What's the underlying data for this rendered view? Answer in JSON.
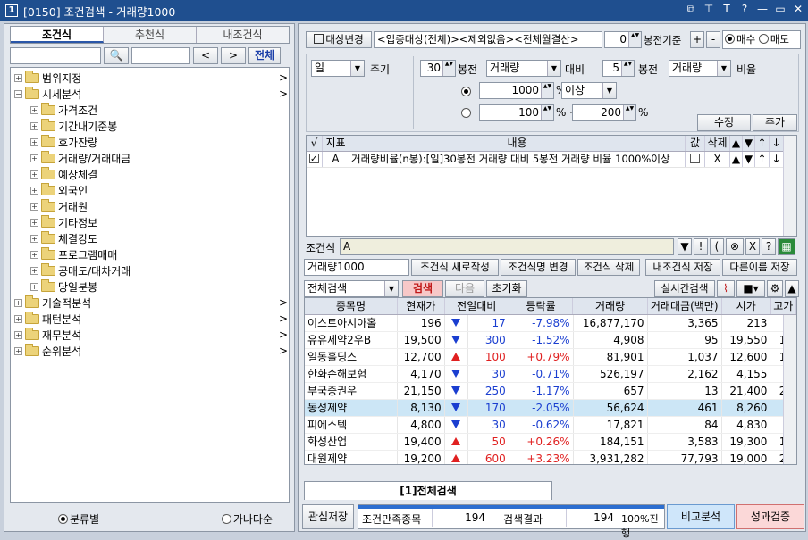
{
  "window": {
    "num": "1",
    "title": "[0150] 조건검색 - 거래량1000",
    "icons": [
      "layout-icon",
      "pin-icon",
      "font-icon",
      "help-icon",
      "minimize-icon",
      "maximize-icon",
      "close-icon"
    ],
    "icon_glyphs": [
      "⧉",
      "⊤",
      "T",
      "?",
      "—",
      "▭",
      "✕"
    ]
  },
  "left": {
    "tabs": [
      "조건식",
      "추천식",
      "내조건식"
    ],
    "search_btn": "🔍",
    "prev": "<",
    "next": ">",
    "all": "전체",
    "tree": [
      {
        "label": "범위지정",
        "level": 0,
        "arrow": ">"
      },
      {
        "label": "시세분석",
        "level": 0,
        "arrow": ">",
        "open": true
      },
      {
        "label": "가격조건",
        "level": 1
      },
      {
        "label": "기간내기준봉",
        "level": 1
      },
      {
        "label": "호가잔량",
        "level": 1
      },
      {
        "label": "거래량/거래대금",
        "level": 1
      },
      {
        "label": "예상체결",
        "level": 1
      },
      {
        "label": "외국인",
        "level": 1
      },
      {
        "label": "거래원",
        "level": 1
      },
      {
        "label": "기타정보",
        "level": 1
      },
      {
        "label": "체결강도",
        "level": 1
      },
      {
        "label": "프로그램매매",
        "level": 1
      },
      {
        "label": "공매도/대차거래",
        "level": 1
      },
      {
        "label": "당일분봉",
        "level": 1
      },
      {
        "label": "기술적분석",
        "level": 0,
        "arrow": ">"
      },
      {
        "label": "패턴분석",
        "level": 0,
        "arrow": ">"
      },
      {
        "label": "재무분석",
        "level": 0,
        "arrow": ">"
      },
      {
        "label": "순위분석",
        "level": 0,
        "arrow": ">"
      }
    ],
    "radio1": "분류별",
    "radio2": "가나다순"
  },
  "right": {
    "target_btn": "대상변경",
    "target_text": "<업종대상(전체)><제외없음><전체월결산>",
    "bong_val": "0",
    "bong_label": "봉전기준",
    "plus": "+",
    "minus": "-",
    "buy": "매수",
    "sell": "매도",
    "period_sel": "일",
    "period_label": "주기",
    "n1": "30",
    "bong1": "봉전",
    "sel1": "거래량",
    "cmp": "대비",
    "n2": "5",
    "bong2": "봉전",
    "sel2": "거래량",
    "ratio": "비율",
    "v1": "1000",
    "pct": "%",
    "cond": "이상",
    "v2": "100",
    "pct_tilde": "% ~",
    "v3": "200",
    "pct2": "%",
    "edit": "수정",
    "add": "추가",
    "grid_head": [
      "√",
      "지표",
      "내용",
      "값",
      "삭제",
      "▲",
      "▼",
      "↑",
      "↓"
    ],
    "grid_row": {
      "ind": "A",
      "content": "거래량비율(n봉):[일]30봉전 거래량 대비 5봉전 거래량 비율 1000%이상",
      "del": "X",
      "u": "▲",
      "d": "▼",
      "uu": "↑",
      "dd": "↓"
    },
    "cond_label": "조건식",
    "cond_val": "A",
    "cond_btns": [
      "▼",
      "!",
      "(",
      ")",
      "⊗",
      "X",
      "?"
    ],
    "name_val": "거래량1000",
    "btns": [
      "조건식 새로작성",
      "조건식명 변경",
      "조건식 삭제",
      "내조건식 저장",
      "다른이름 저장"
    ],
    "scope": "전체검색",
    "search": "검색",
    "next": "다음",
    "reset": "초기화",
    "realtime": "실시간검색",
    "cols": [
      "종목명",
      "현재가",
      "전일대비",
      "등락률",
      "거래량",
      "거래대금(백만)",
      "시가",
      "고가"
    ],
    "rows": [
      [
        "이스트아시아홀",
        "196",
        "dn",
        "17",
        "-7.98%",
        "16,877,170",
        "3,365",
        "213",
        ""
      ],
      [
        "유유제약2우B",
        "19,500",
        "dn",
        "300",
        "-1.52%",
        "4,908",
        "95",
        "19,550",
        "19"
      ],
      [
        "일동홀딩스",
        "12,700",
        "up",
        "100",
        "+0.79%",
        "81,901",
        "1,037",
        "12,600",
        "13"
      ],
      [
        "한화손해보험",
        "4,170",
        "dn",
        "30",
        "-0.71%",
        "526,197",
        "2,162",
        "4,155",
        "4"
      ],
      [
        "부국증권우",
        "21,150",
        "dn",
        "250",
        "-1.17%",
        "657",
        "13",
        "21,400",
        "21"
      ],
      [
        "동성제약",
        "8,130",
        "dn",
        "170",
        "-2.05%",
        "56,624",
        "461",
        "8,260",
        "8"
      ],
      [
        "피에스텍",
        "4,800",
        "dn",
        "30",
        "-0.62%",
        "17,821",
        "84",
        "4,830",
        "4"
      ],
      [
        "화성산업",
        "19,400",
        "up",
        "50",
        "+0.26%",
        "184,151",
        "3,583",
        "19,300",
        "19"
      ],
      [
        "대원제약",
        "19,200",
        "up",
        "600",
        "+3.23%",
        "3,931,282",
        "77,793",
        "19,000",
        "20"
      ]
    ],
    "result_tab": "[1]전체검색",
    "save_interest": "관심저장",
    "cnt_label": "조건만족종목",
    "cnt": "194",
    "res_label": "검색결과",
    "res": "194",
    "progress": "100%진행",
    "progress_value": 100,
    "compare": "비교분석",
    "verify": "성과검증"
  }
}
